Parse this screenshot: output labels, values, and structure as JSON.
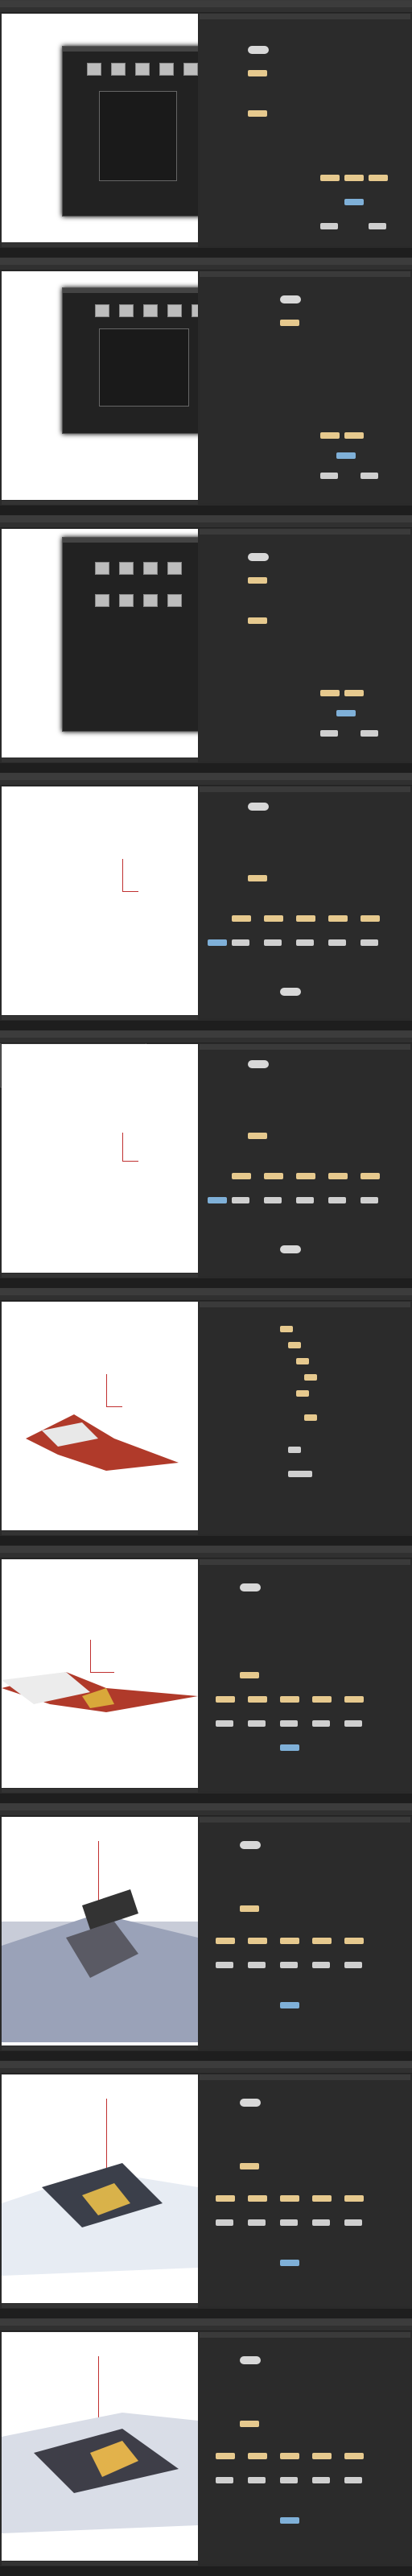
{
  "frames": [
    {
      "id": 1,
      "state": "asset-browser-dialog"
    },
    {
      "id": 2,
      "state": "asset-browser-dialog-selected"
    },
    {
      "id": 3,
      "state": "asset-browser-grid"
    },
    {
      "id": 4,
      "state": "empty-viewport"
    },
    {
      "id": 5,
      "state": "file-menu-open"
    },
    {
      "id": 6,
      "state": "red-mesh-preview"
    },
    {
      "id": 7,
      "state": "red-mesh-closeup"
    },
    {
      "id": 8,
      "state": "textured-terrain"
    },
    {
      "id": 9,
      "state": "textured-object"
    },
    {
      "id": 10,
      "state": "textured-object-alt"
    }
  ],
  "colors": {
    "node_tan": "#e6c98e",
    "node_grey": "#cfcfcf",
    "node_blue": "#7fb0d8",
    "accent_orange": "#e08a2a",
    "axis_red": "#c03030"
  }
}
